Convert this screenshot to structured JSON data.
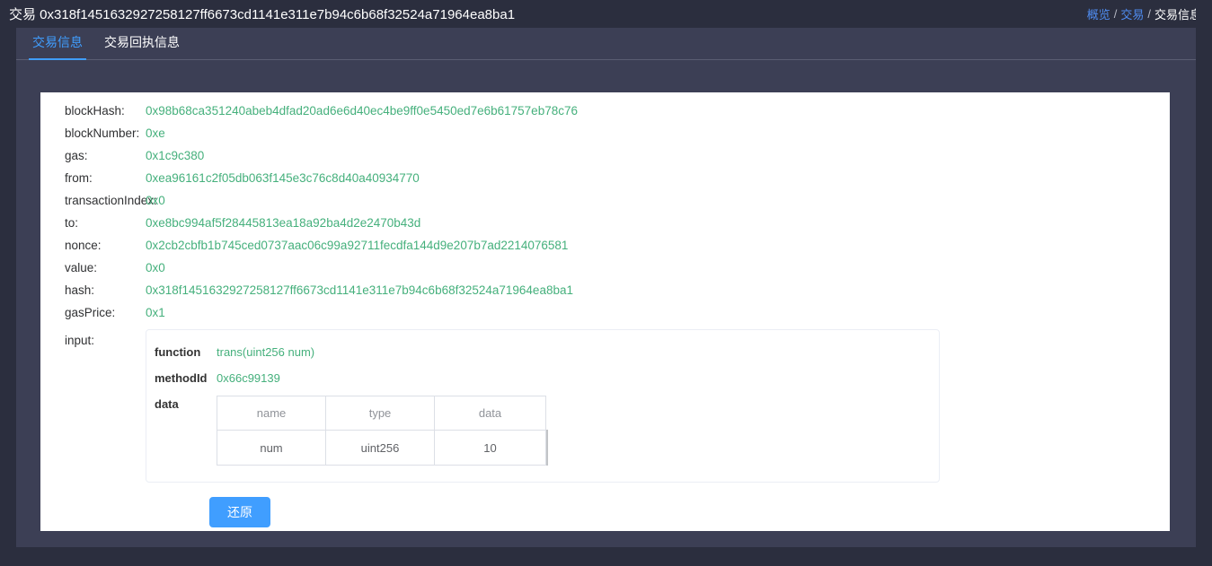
{
  "header": {
    "title_prefix": "交易",
    "title_hash": "0x318f1451632927258127ff6673cd1141e311e7b94c6b68f32524a71964ea8ba1",
    "title": "交易 0x318f1451632927258127ff6673cd1141e311e7b94c6b68f32524a71964ea8ba1"
  },
  "breadcrumb": {
    "items": [
      {
        "label": "概览",
        "type": "link"
      },
      {
        "label": "交易",
        "type": "link"
      },
      {
        "label": "交易信息",
        "type": "current"
      }
    ],
    "separator": "/"
  },
  "tabs": [
    {
      "label": "交易信息",
      "active": true
    },
    {
      "label": "交易回执信息",
      "active": false
    }
  ],
  "fields": [
    {
      "label": "blockHash:",
      "value": "0x98b68ca351240abeb4dfad20ad6e6d40ec4be9ff0e5450ed7e6b61757eb78c76"
    },
    {
      "label": "blockNumber:",
      "value": "0xe"
    },
    {
      "label": "gas:",
      "value": "0x1c9c380"
    },
    {
      "label": "from:",
      "value": "0xea96161c2f05db063f145e3c76c8d40a40934770"
    },
    {
      "label": "transactionIndex:",
      "value": "0x0"
    },
    {
      "label": "to:",
      "value": "0xe8bc994af5f28445813ea18a92ba4d2e2470b43d"
    },
    {
      "label": "nonce:",
      "value": "0x2cb2cbfb1b745ced0737aac06c99a92711fecdfa144d9e207b7ad2214076581"
    },
    {
      "label": "value:",
      "value": "0x0"
    },
    {
      "label": "hash:",
      "value": "0x318f1451632927258127ff6673cd1141e311e7b94c6b68f32524a71964ea8ba1"
    },
    {
      "label": "gasPrice:",
      "value": "0x1"
    }
  ],
  "input": {
    "label": "input:",
    "function_key": "function",
    "function_value": "trans(uint256 num)",
    "methodid_key": "methodId",
    "methodid_value": "0x66c99139",
    "data_key": "data",
    "table": {
      "headers": [
        "name",
        "type",
        "data"
      ],
      "rows": [
        [
          "num",
          "uint256",
          "10"
        ]
      ]
    }
  },
  "actions": {
    "restore_label": "还原"
  },
  "colors": {
    "accent": "#409eff",
    "value_green": "#45b07c",
    "panel_dark": "#2b2e3e",
    "panel_navy": "#3c3f55",
    "card_white": "#ffffff"
  }
}
